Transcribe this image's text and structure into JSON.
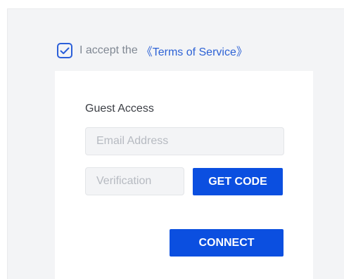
{
  "terms": {
    "checked": true,
    "prefix": "I accept the",
    "link_label": "《Terms of Service》"
  },
  "guest": {
    "title": "Guest Access",
    "email_placeholder": "Email Address",
    "code_placeholder": "Verification",
    "get_code_label": "GET CODE",
    "connect_label": "CONNECT"
  },
  "colors": {
    "accent": "#0b4fe0",
    "link": "#2d62d5",
    "panel_bg": "#f3f4f6"
  }
}
